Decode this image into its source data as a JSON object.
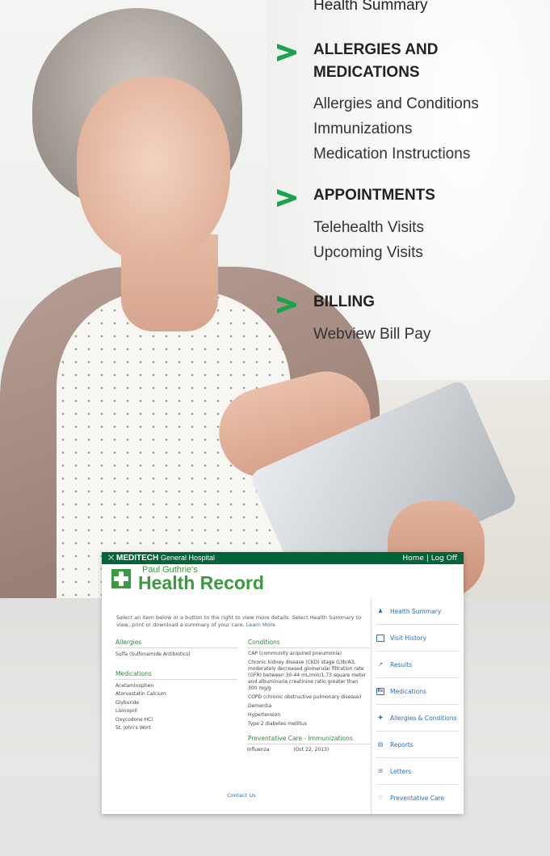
{
  "menu": {
    "top_item": "Health Summary",
    "accent_color": "#1aa34a",
    "sections": [
      {
        "title": "ALLERGIES AND",
        "title2": "MEDICATIONS",
        "items": [
          "Allergies and Conditions",
          "Immunizations",
          "Medication Instructions"
        ]
      },
      {
        "title": "APPOINTMENTS",
        "items": [
          "Telehealth Visits",
          "Upcoming Visits"
        ]
      },
      {
        "title": "BILLING",
        "items": [
          "Webview Bill Pay"
        ]
      }
    ]
  },
  "portal": {
    "brand": "MEDITECH",
    "brand_suffix": "General Hospital",
    "links": {
      "home": "Home",
      "separator": "|",
      "logoff": "Log Off"
    },
    "patient": "Paul Guthrie's",
    "title": "Health Record",
    "intro": "Select an item below or a button to the right to view more details. Select Health Summary to view, print or download a summary of your care.",
    "learn_more": "Learn More",
    "allergies": {
      "heading": "Allergies",
      "items": [
        "Sulfa (Sulfonamide Antibiotics)"
      ]
    },
    "medications": {
      "heading": "Medications",
      "items": [
        "Acetaminophen",
        "Atorvastatin Calcium",
        "Glyburide",
        "Lisinopril",
        "Oxycodone HCl",
        "St. John's Wort"
      ]
    },
    "conditions": {
      "heading": "Conditions",
      "items": [
        "CAP (community acquired pneumonia)",
        "Chronic kidney disease (CKD) stage G3b/A3, moderately decreased glomerular filtration rate (GFR) between 30-44 mL/min/1.73 square meter and albuminuria creatinine ratio greater than 300 mg/g",
        "COPD (chronic obstructive pulmonary disease)",
        "Dementia",
        "Hypertension",
        "Type 2 diabetes mellitus"
      ]
    },
    "immunizations": {
      "heading": "Preventative Care - Immunizations",
      "name": "Influenza",
      "date": "(Oct 22, 2013)"
    },
    "contact": "Contact Us",
    "nav": [
      {
        "label": "Health Summary",
        "icon": "person-icon"
      },
      {
        "label": "Visit History",
        "icon": "calendar-icon"
      },
      {
        "label": "Results",
        "icon": "chart-icon"
      },
      {
        "label": "Medications",
        "icon": "rx-icon"
      },
      {
        "label": "Allergies & Conditions",
        "icon": "plus-icon"
      },
      {
        "label": "Reports",
        "icon": "document-icon"
      },
      {
        "label": "Letters",
        "icon": "envelope-icon"
      },
      {
        "label": "Preventative Care",
        "icon": "heart-icon"
      }
    ]
  }
}
